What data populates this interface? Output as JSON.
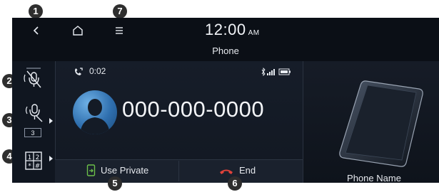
{
  "callouts": [
    "1",
    "2",
    "3",
    "4",
    "5",
    "6",
    "7"
  ],
  "topbar": {
    "back_icon": "chevron-left-icon",
    "home_icon": "home-icon",
    "menu_icon": "menu-icon",
    "time": "12:00",
    "ampm": "AM"
  },
  "app": {
    "title": "Phone"
  },
  "side": {
    "mute_icon": "microphone-mute-icon",
    "mic_volume_icon": "microphone-volume-icon",
    "mic_volume_level": "3",
    "keypad_icon": "dial-keypad-icon"
  },
  "call": {
    "duration": "0:02",
    "number": "000-000-0000",
    "status_icons": [
      "bluetooth-icon",
      "signal-icon",
      "battery-icon"
    ]
  },
  "buttons": {
    "use_private": "Use Private",
    "end": "End"
  },
  "device": {
    "name": "Phone Name"
  },
  "colors": {
    "end_red": "#e0423a",
    "private_green": "#6cc04a",
    "background": "#0b0f16"
  }
}
